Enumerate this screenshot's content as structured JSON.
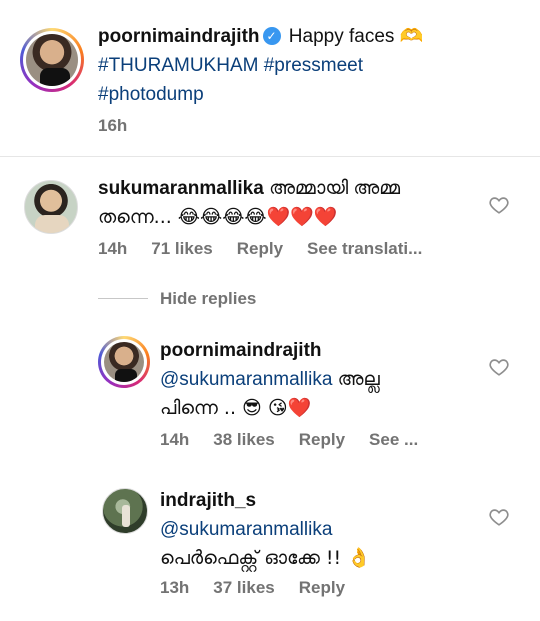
{
  "caption": {
    "username": "poornimaindrajith",
    "text": "Happy faces 🫶",
    "hashtags_line1": "#THURAMUKHAM #pressmeet",
    "hashtags_line2": "#photodump",
    "time": "16h"
  },
  "comment1": {
    "username": "sukumaranmallika",
    "text_line1": "അമ്മായി അമ്മ",
    "text_line2": "തന്നെ... 😂😂😂😂❤️❤️❤️",
    "time": "14h",
    "likes": "71 likes",
    "reply": "Reply",
    "translate": "See translati..."
  },
  "hide_replies": "Hide replies",
  "reply1": {
    "username": "poornimaindrajith",
    "mention": "@sukumaranmallika",
    "text_tail": " അല്ല",
    "text_line2": "പിന്നെ .. 😎 😘❤️",
    "time": "14h",
    "likes": "38 likes",
    "reply": "Reply",
    "translate": "See ..."
  },
  "reply2": {
    "username": "indrajith_s",
    "mention": "@sukumaranmallika",
    "text_line2": "പെർഫെക്റ്റ് ഓക്കേ !! 👌",
    "time": "13h",
    "likes": "37 likes",
    "reply": "Reply"
  },
  "icons": {
    "heart": "heart-outline-icon",
    "verified": "verified-badge-icon"
  },
  "colors": {
    "hashtag": "#0b3f7a",
    "meta": "#737373",
    "verified": "#3897f0"
  }
}
